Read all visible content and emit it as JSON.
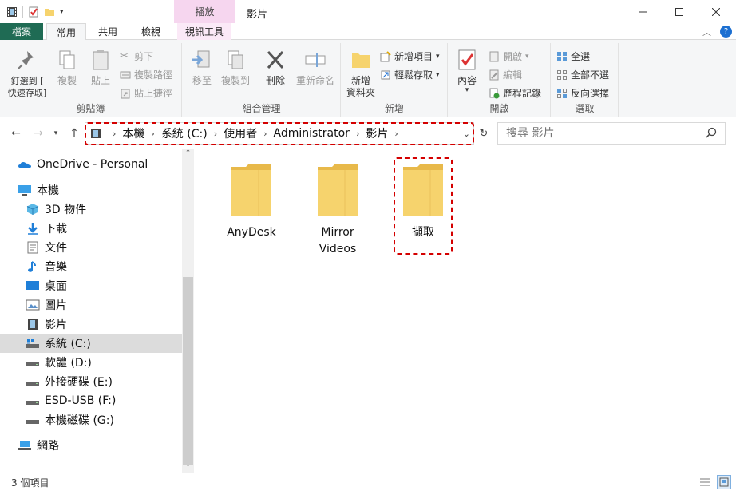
{
  "window": {
    "title": "影片",
    "context_tab": "播放"
  },
  "tabs": {
    "file": "檔案",
    "home": "常用",
    "share": "共用",
    "view": "檢視",
    "video_tools": "視訊工具"
  },
  "ribbon": {
    "clipboard": {
      "label": "剪貼簿",
      "pin": "釘選到 [\n快速存取]",
      "copy": "複製",
      "paste": "貼上",
      "cut": "剪下",
      "copy_path": "複製路徑",
      "paste_shortcut": "貼上捷徑"
    },
    "organize": {
      "label": "組合管理",
      "move_to": "移至",
      "copy_to": "複製到",
      "delete": "刪除",
      "rename": "重新命名"
    },
    "new": {
      "label": "新增",
      "new_folder": "新增\n資料夾",
      "new_item": "新增項目",
      "easy_access": "輕鬆存取"
    },
    "open": {
      "label": "開啟",
      "properties": "內容",
      "open": "開啟",
      "edit": "編輯",
      "history": "歷程記錄"
    },
    "select": {
      "label": "選取",
      "select_all": "全選",
      "select_none": "全部不選",
      "invert": "反向選擇"
    }
  },
  "address": {
    "crumbs": [
      "本機",
      "系統 (C:)",
      "使用者",
      "Administrator",
      "影片"
    ],
    "search_placeholder": "搜尋 影片"
  },
  "sidebar": {
    "items": [
      {
        "label": "OneDrive - Personal",
        "icon": "cloud-icon"
      },
      {
        "label": "本機",
        "icon": "computer-icon"
      },
      {
        "label": "3D 物件",
        "icon": "cube-icon"
      },
      {
        "label": "下載",
        "icon": "download-icon"
      },
      {
        "label": "文件",
        "icon": "document-icon"
      },
      {
        "label": "音樂",
        "icon": "music-icon"
      },
      {
        "label": "桌面",
        "icon": "desktop-icon"
      },
      {
        "label": "圖片",
        "icon": "pictures-icon"
      },
      {
        "label": "影片",
        "icon": "videos-icon"
      },
      {
        "label": "系統 (C:)",
        "icon": "system-drive-icon"
      },
      {
        "label": "軟體 (D:)",
        "icon": "drive-icon"
      },
      {
        "label": "外接硬碟 (E:)",
        "icon": "drive-icon"
      },
      {
        "label": "ESD-USB (F:)",
        "icon": "drive-icon"
      },
      {
        "label": "本機磁碟 (G:)",
        "icon": "drive-icon"
      },
      {
        "label": "網路",
        "icon": "network-icon"
      }
    ],
    "selected": "系統 (C:)"
  },
  "folders": [
    {
      "name": "AnyDesk"
    },
    {
      "name": "Mirror\nVideos"
    },
    {
      "name": "擷取"
    }
  ],
  "status": {
    "count": "3 個項目"
  },
  "colors": {
    "file_tab": "#1f6b54",
    "context_tab": "#f6d6ef",
    "highlight": "#d40000",
    "folder": "#f6d36d"
  }
}
